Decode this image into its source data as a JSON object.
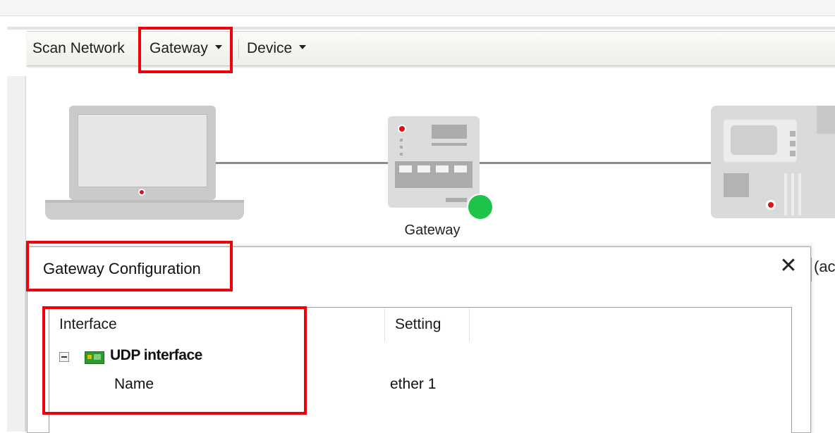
{
  "toolbar": {
    "scan_network": "Scan Network",
    "gateway": "Gateway",
    "device": "Device"
  },
  "topology": {
    "gateway_label": "Gateway",
    "gateway_status_color": "#1ec34a"
  },
  "background_text": "(act",
  "dialog": {
    "title": "Gateway Configuration",
    "close_symbol": "✕",
    "columns": [
      "Interface",
      "Setting"
    ],
    "tree": {
      "node_label": "UDP interface",
      "node_expanded": true,
      "children": [
        {
          "name": "Name",
          "value": "ether 1"
        }
      ]
    }
  },
  "highlight_color": "#f0000d",
  "icons": {
    "network_card": "network-card-icon",
    "collapse": "collapse-icon",
    "close": "close-icon",
    "dropdown": "chevron-down-icon"
  }
}
